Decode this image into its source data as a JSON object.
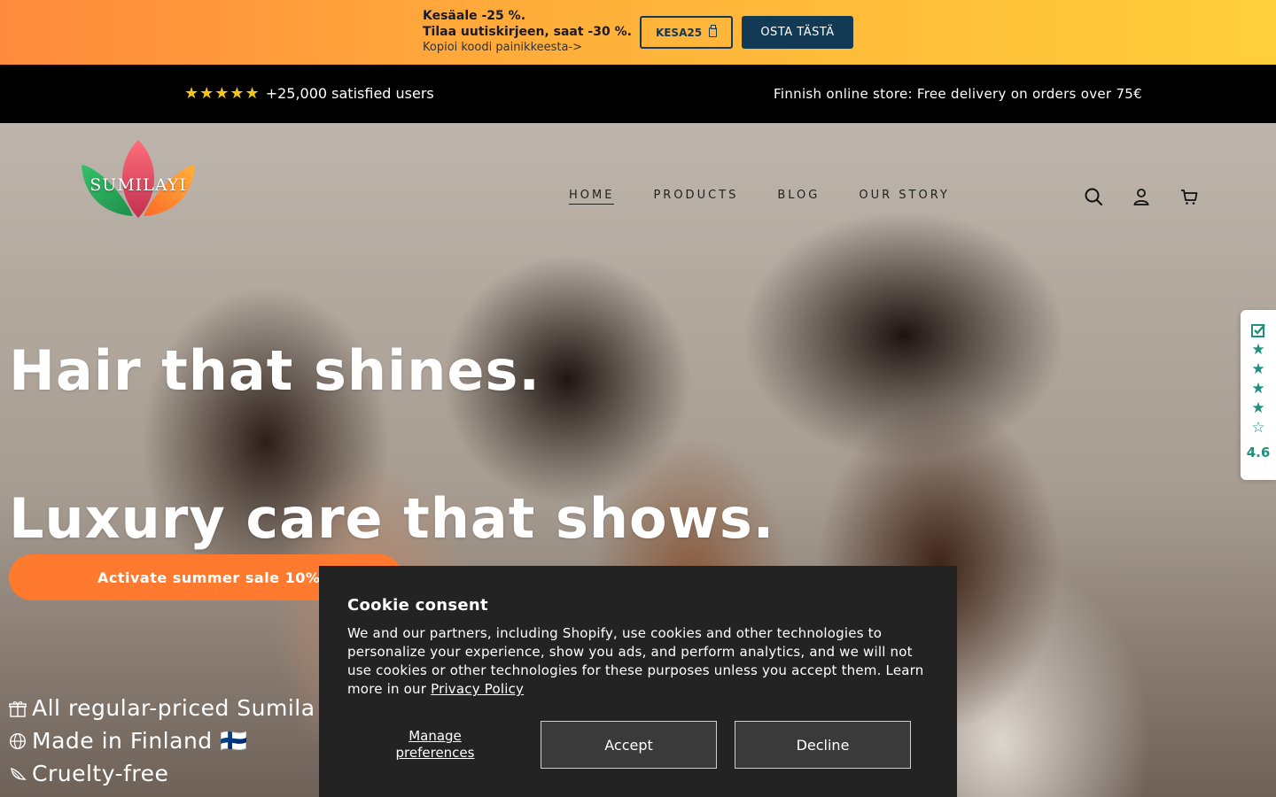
{
  "promo": {
    "line1": "Kesäale -25 %.",
    "line2": "Tilaa uutiskirjeen, saat -30 %.",
    "line3": "Kopioi koodi painikkeesta->",
    "code": "KESA25",
    "shop_label": "OSTA TÄSTÄ"
  },
  "announcement": {
    "stars": "★★★★★",
    "users": "+25,000 satisfied users",
    "delivery": "Finnish online store: Free delivery on orders over 75€"
  },
  "header": {
    "logo_text": "SUMILAYI",
    "nav": [
      "HOME",
      "PRODUCTS",
      "BLOG",
      "OUR STORY"
    ]
  },
  "hero": {
    "headline1": "Hair that shines.",
    "headline2": "Luxury care that shows.",
    "cta": "Activate summer sale 10%",
    "features": [
      {
        "icon": "gift-icon",
        "text": "All regular-priced Sumila"
      },
      {
        "icon": "globe-icon",
        "text": "Made in Finland 🇫🇮"
      },
      {
        "icon": "leaf-icon",
        "text": "Cruelty-free"
      }
    ]
  },
  "reviews_widget": {
    "score": "4.6"
  },
  "cookie": {
    "title": "Cookie consent",
    "body": "We and our partners, including Shopify, use cookies and other technologies to personalize your experience, show you ads, and perform analytics, and we will not use cookies or other technologies for these purposes unless you accept them. Learn more in our ",
    "policy_link": "Privacy Policy",
    "manage": "Manage preferences",
    "accept": "Accept",
    "decline": "Decline"
  },
  "colors": {
    "accent": "#ff7a2e",
    "navy": "#123a55",
    "review_green": "#1f8f7e",
    "star_yellow": "#f5c518"
  }
}
